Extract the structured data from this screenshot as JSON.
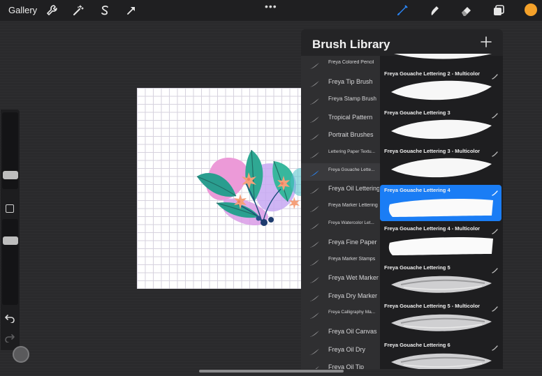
{
  "topbar": {
    "gallery_label": "Gallery",
    "tools": [
      "wrench-icon",
      "magic-wand-icon",
      "selection-icon",
      "transform-icon"
    ],
    "more_label": "•••",
    "right_tools": [
      "brush-icon",
      "smudge-icon",
      "eraser-icon",
      "layers-icon"
    ],
    "current_color": "#f4a12a"
  },
  "sidebar": {
    "size_slider_level": 0.45,
    "opacity_slider_level": 0.45
  },
  "panel": {
    "title": "Brush Library",
    "add_icon": "plus-icon",
    "accent": "#1a7df5",
    "brush_sets": [
      {
        "label": "Freya Colored Pencil",
        "size": 7
      },
      {
        "label": "Freya Tip Brush",
        "size": 9
      },
      {
        "label": "Freya Stamp Brush",
        "size": 8
      },
      {
        "label": "Tropical Pattern",
        "size": 9
      },
      {
        "label": "Portrait Brushes",
        "size": 9
      },
      {
        "label": "Lettering Paper Textu...",
        "size": 6.5
      },
      {
        "label": "Freya Gouache Lette...",
        "size": 6.5,
        "selected": true
      },
      {
        "label": "Freya Oil Lettering",
        "size": 9
      },
      {
        "label": "Freya Marker Lettering",
        "size": 7
      },
      {
        "label": "Freya Watercolor Let...",
        "size": 6.5
      },
      {
        "label": "Freya Fine Paper",
        "size": 9
      },
      {
        "label": "Freya Marker Stamps",
        "size": 7
      },
      {
        "label": "Freya Wet Marker",
        "size": 9
      },
      {
        "label": "Freya Dry Marker",
        "size": 9
      },
      {
        "label": "Freya Calligraphy Ma...",
        "size": 6.5
      },
      {
        "label": "Freya Oil Canvas",
        "size": 9
      },
      {
        "label": "Freya Oil Dry",
        "size": 9
      },
      {
        "label": "Freya Oil Tip",
        "size": 9
      }
    ],
    "brushes": [
      {
        "name": "Freya Gouache Lettering 2 - Multicolor",
        "style": "gouache"
      },
      {
        "name": "Freya Gouache Lettering 3",
        "style": "gouache"
      },
      {
        "name": "Freya Gouache Lettering 3 - Multicolor",
        "style": "gouache"
      },
      {
        "name": "Freya Gouache Lettering 4",
        "style": "flat",
        "selected": true
      },
      {
        "name": "Freya Gouache Lettering 4 - Multicolor",
        "style": "flat"
      },
      {
        "name": "Freya Gouache Lettering 5",
        "style": "textured"
      },
      {
        "name": "Freya Gouache Lettering 5 - Multicolor",
        "style": "textured"
      },
      {
        "name": "Freya Gouache Lettering 6",
        "style": "textured"
      }
    ]
  }
}
